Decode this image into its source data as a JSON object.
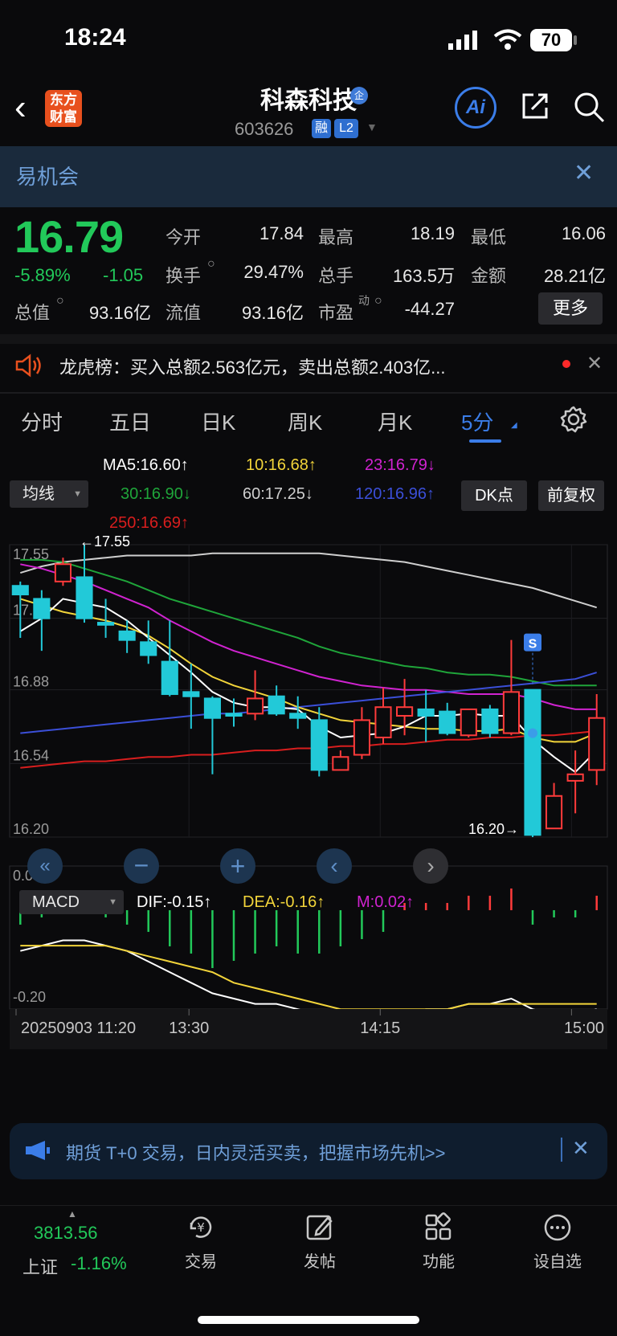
{
  "status_bar": {
    "time": "18:24",
    "battery": "70"
  },
  "header": {
    "logo_line1": "东方",
    "logo_line2": "财富",
    "stock_name": "科森科技",
    "stock_badge": "企",
    "stock_code": "603626",
    "tag_rong": "融",
    "tag_l2": "L2",
    "ai_label": "Ai"
  },
  "banner": {
    "text": "易机会"
  },
  "quote": {
    "price": "16.79",
    "pct_change": "-5.89%",
    "change": "-1.05",
    "open_label": "今开",
    "open": "17.84",
    "high_label": "最高",
    "high": "18.19",
    "low_label": "最低",
    "low": "16.06",
    "turnover_rate_label": "换手",
    "turnover_rate": "29.47%",
    "volume_label": "总手",
    "volume": "163.5万",
    "amount_label": "金额",
    "amount": "28.21亿",
    "market_cap_label": "总值",
    "market_cap": "93.16亿",
    "float_cap_label": "流值",
    "float_cap": "93.16亿",
    "pe_label": "市盈",
    "pe_sup": "动",
    "pe": "-44.27",
    "more_label": "更多"
  },
  "dragon_tiger": {
    "text": "龙虎榜：买入总额2.563亿元，卖出总额2.403亿..."
  },
  "tabs": [
    "分时",
    "五日",
    "日K",
    "周K",
    "月K",
    "5分"
  ],
  "active_tab_index": 5,
  "ma_legend": {
    "select_label": "均线",
    "ma5": "MA5:16.60↑",
    "ma10": "10:16.68↑",
    "ma23": "23:16.79↓",
    "ma30": "30:16.90↓",
    "ma60": "60:17.25↓",
    "ma120": "120:16.96↑",
    "ma250": "250:16.69↑",
    "dk_label": "DK点",
    "fq_label": "前复权"
  },
  "colors": {
    "up": "#ff3b3b",
    "down": "#22c9d8",
    "ma5": "#ffffff",
    "ma10": "#f2d43a",
    "ma23": "#d023d0",
    "ma30": "#1fa53a",
    "ma60": "#cfcfcf",
    "ma120": "#3b4fd8",
    "ma250": "#d81e1e",
    "dif": "#ffffff",
    "dea": "#f2d43a",
    "m": "#d023d0"
  },
  "chart_data": {
    "type": "candlestick",
    "interval": "5分",
    "y_ticks": [
      "17.55",
      "17.21",
      "16.88",
      "16.54",
      "16.20"
    ],
    "max_label": "17.55",
    "min_label": "16.20",
    "signal_label": "S",
    "candles": [
      {
        "o": 17.36,
        "c": 17.32,
        "h": 17.38,
        "l": 17.12
      },
      {
        "o": 17.3,
        "c": 17.21,
        "h": 17.34,
        "l": 17.06
      },
      {
        "o": 17.38,
        "c": 17.46,
        "h": 17.49,
        "l": 17.36
      },
      {
        "o": 17.4,
        "c": 17.21,
        "h": 17.55,
        "l": 17.19
      },
      {
        "o": 17.19,
        "c": 17.18,
        "h": 17.3,
        "l": 17.12
      },
      {
        "o": 17.15,
        "c": 17.11,
        "h": 17.2,
        "l": 17.05
      },
      {
        "o": 17.1,
        "c": 17.04,
        "h": 17.2,
        "l": 17.0
      },
      {
        "o": 17.01,
        "c": 16.86,
        "h": 17.2,
        "l": 16.85
      },
      {
        "o": 16.87,
        "c": 16.85,
        "h": 17.0,
        "l": 16.7
      },
      {
        "o": 16.84,
        "c": 16.75,
        "h": 16.85,
        "l": 16.49
      },
      {
        "o": 16.77,
        "c": 16.76,
        "h": 16.84,
        "l": 16.71
      },
      {
        "o": 16.77,
        "c": 16.84,
        "h": 16.97,
        "l": 16.74
      },
      {
        "o": 16.85,
        "c": 16.77,
        "h": 16.9,
        "l": 16.76
      },
      {
        "o": 16.77,
        "c": 16.75,
        "h": 16.85,
        "l": 16.7
      },
      {
        "o": 16.74,
        "c": 16.51,
        "h": 16.8,
        "l": 16.48
      },
      {
        "o": 16.51,
        "c": 16.57,
        "h": 16.6,
        "l": 16.51
      },
      {
        "o": 16.58,
        "c": 16.74,
        "h": 16.8,
        "l": 16.56
      },
      {
        "o": 16.66,
        "c": 16.8,
        "h": 16.89,
        "l": 16.63
      },
      {
        "o": 16.76,
        "c": 16.8,
        "h": 16.93,
        "l": 16.67
      },
      {
        "o": 16.79,
        "c": 16.76,
        "h": 16.88,
        "l": 16.64
      },
      {
        "o": 16.78,
        "c": 16.68,
        "h": 16.82,
        "l": 16.67
      },
      {
        "o": 16.67,
        "c": 16.79,
        "h": 16.79,
        "l": 16.66
      },
      {
        "o": 16.79,
        "c": 16.68,
        "h": 16.81,
        "l": 16.66
      },
      {
        "o": 16.68,
        "c": 16.87,
        "h": 17.11,
        "l": 16.67
      },
      {
        "o": 16.88,
        "c": 16.21,
        "h": 16.88,
        "l": 16.2
      },
      {
        "o": 16.24,
        "c": 16.39,
        "h": 16.45,
        "l": 16.24
      },
      {
        "o": 16.46,
        "c": 16.49,
        "h": 16.6,
        "l": 16.31
      },
      {
        "o": 16.51,
        "c": 16.75,
        "h": 16.86,
        "l": 16.44
      }
    ],
    "ma_lines": {
      "ma60": [
        17.42,
        17.45,
        17.47,
        17.48,
        17.49,
        17.5,
        17.5,
        17.5,
        17.5,
        17.51,
        17.51,
        17.51,
        17.51,
        17.51,
        17.51,
        17.5,
        17.49,
        17.48,
        17.47,
        17.45,
        17.43,
        17.41,
        17.39,
        17.37,
        17.35,
        17.32,
        17.29,
        17.26
      ],
      "ma30": [
        17.48,
        17.48,
        17.47,
        17.44,
        17.41,
        17.38,
        17.34,
        17.3,
        17.27,
        17.24,
        17.21,
        17.18,
        17.15,
        17.12,
        17.08,
        17.05,
        17.03,
        17.01,
        16.99,
        16.98,
        16.96,
        16.95,
        16.95,
        16.94,
        16.92,
        16.9,
        16.9,
        16.9
      ],
      "ma23": [
        17.46,
        17.44,
        17.41,
        17.38,
        17.34,
        17.3,
        17.26,
        17.2,
        17.15,
        17.1,
        17.06,
        17.03,
        17.0,
        16.97,
        16.94,
        16.92,
        16.9,
        16.89,
        16.88,
        16.88,
        16.87,
        16.86,
        16.86,
        16.86,
        16.84,
        16.81,
        16.79,
        16.79
      ],
      "ma120": [
        16.68,
        16.69,
        16.7,
        16.71,
        16.72,
        16.73,
        16.74,
        16.75,
        16.76,
        16.77,
        16.77,
        16.78,
        16.79,
        16.8,
        16.81,
        16.82,
        16.83,
        16.84,
        16.85,
        16.86,
        16.87,
        16.88,
        16.89,
        16.9,
        16.91,
        16.92,
        16.93,
        16.96
      ],
      "ma10": [
        17.3,
        17.27,
        17.24,
        17.22,
        17.2,
        17.17,
        17.13,
        17.07,
        17.0,
        16.94,
        16.9,
        16.87,
        16.84,
        16.8,
        16.77,
        16.74,
        16.73,
        16.72,
        16.71,
        16.7,
        16.7,
        16.69,
        16.69,
        16.7,
        16.66,
        16.64,
        16.64,
        16.68
      ],
      "ma250": [
        16.52,
        16.53,
        16.54,
        16.55,
        16.55,
        16.56,
        16.57,
        16.57,
        16.58,
        16.58,
        16.59,
        16.6,
        16.6,
        16.61,
        16.61,
        16.62,
        16.62,
        16.63,
        16.63,
        16.64,
        16.65,
        16.65,
        16.66,
        16.66,
        16.67,
        16.67,
        16.68,
        16.69
      ],
      "ma5": [
        17.15,
        17.21,
        17.3,
        17.28,
        17.26,
        17.2,
        17.12,
        17.04,
        16.96,
        16.87,
        16.82,
        16.8,
        16.8,
        16.79,
        16.71,
        16.66,
        16.67,
        16.68,
        16.71,
        16.76,
        16.76,
        16.77,
        16.76,
        16.76,
        16.65,
        16.57,
        16.5,
        16.6
      ]
    },
    "macd": {
      "select_label": "MACD",
      "dif_label": "DIF:-0.15↑",
      "dea_label": "DEA:-0.16↑",
      "m_label": "M:0.02↑",
      "y_ticks": [
        "0.05",
        "-0.20"
      ],
      "dif": [
        -0.08,
        -0.07,
        -0.06,
        -0.06,
        -0.07,
        -0.08,
        -0.1,
        -0.12,
        -0.14,
        -0.16,
        -0.17,
        -0.18,
        -0.18,
        -0.19,
        -0.2,
        -0.21,
        -0.22,
        -0.21,
        -0.2,
        -0.19,
        -0.19,
        -0.18,
        -0.18,
        -0.17,
        -0.19,
        -0.2,
        -0.2,
        -0.19
      ],
      "dea": [
        -0.07,
        -0.07,
        -0.07,
        -0.07,
        -0.07,
        -0.08,
        -0.09,
        -0.1,
        -0.11,
        -0.12,
        -0.14,
        -0.15,
        -0.16,
        -0.17,
        -0.18,
        -0.19,
        -0.19,
        -0.19,
        -0.19,
        -0.19,
        -0.19,
        -0.18,
        -0.18,
        -0.18,
        -0.18,
        -0.18,
        -0.18,
        -0.18
      ],
      "m": [
        -0.02,
        -0.01,
        0.01,
        0.01,
        -0.01,
        -0.02,
        -0.03,
        -0.05,
        -0.06,
        -0.08,
        -0.07,
        -0.06,
        -0.05,
        -0.06,
        -0.06,
        -0.05,
        -0.04,
        -0.03,
        0.01,
        0.01,
        0.01,
        0.02,
        0.02,
        0.03,
        -0.02,
        -0.01,
        -0.01,
        0.02
      ]
    },
    "x_ticks": [
      "20250903 11:20",
      "13:30",
      "14:15",
      "15:00"
    ]
  },
  "promo": {
    "text": "期货 T+0 交易，日内灵活买卖，把握市场先机>>"
  },
  "bottom_nav": {
    "index_value": "3813.56",
    "index_name": "上证",
    "index_change": "-1.16%",
    "trade_label": "交易",
    "post_label": "发帖",
    "function_label": "功能",
    "watchlist_label": "设自选"
  }
}
